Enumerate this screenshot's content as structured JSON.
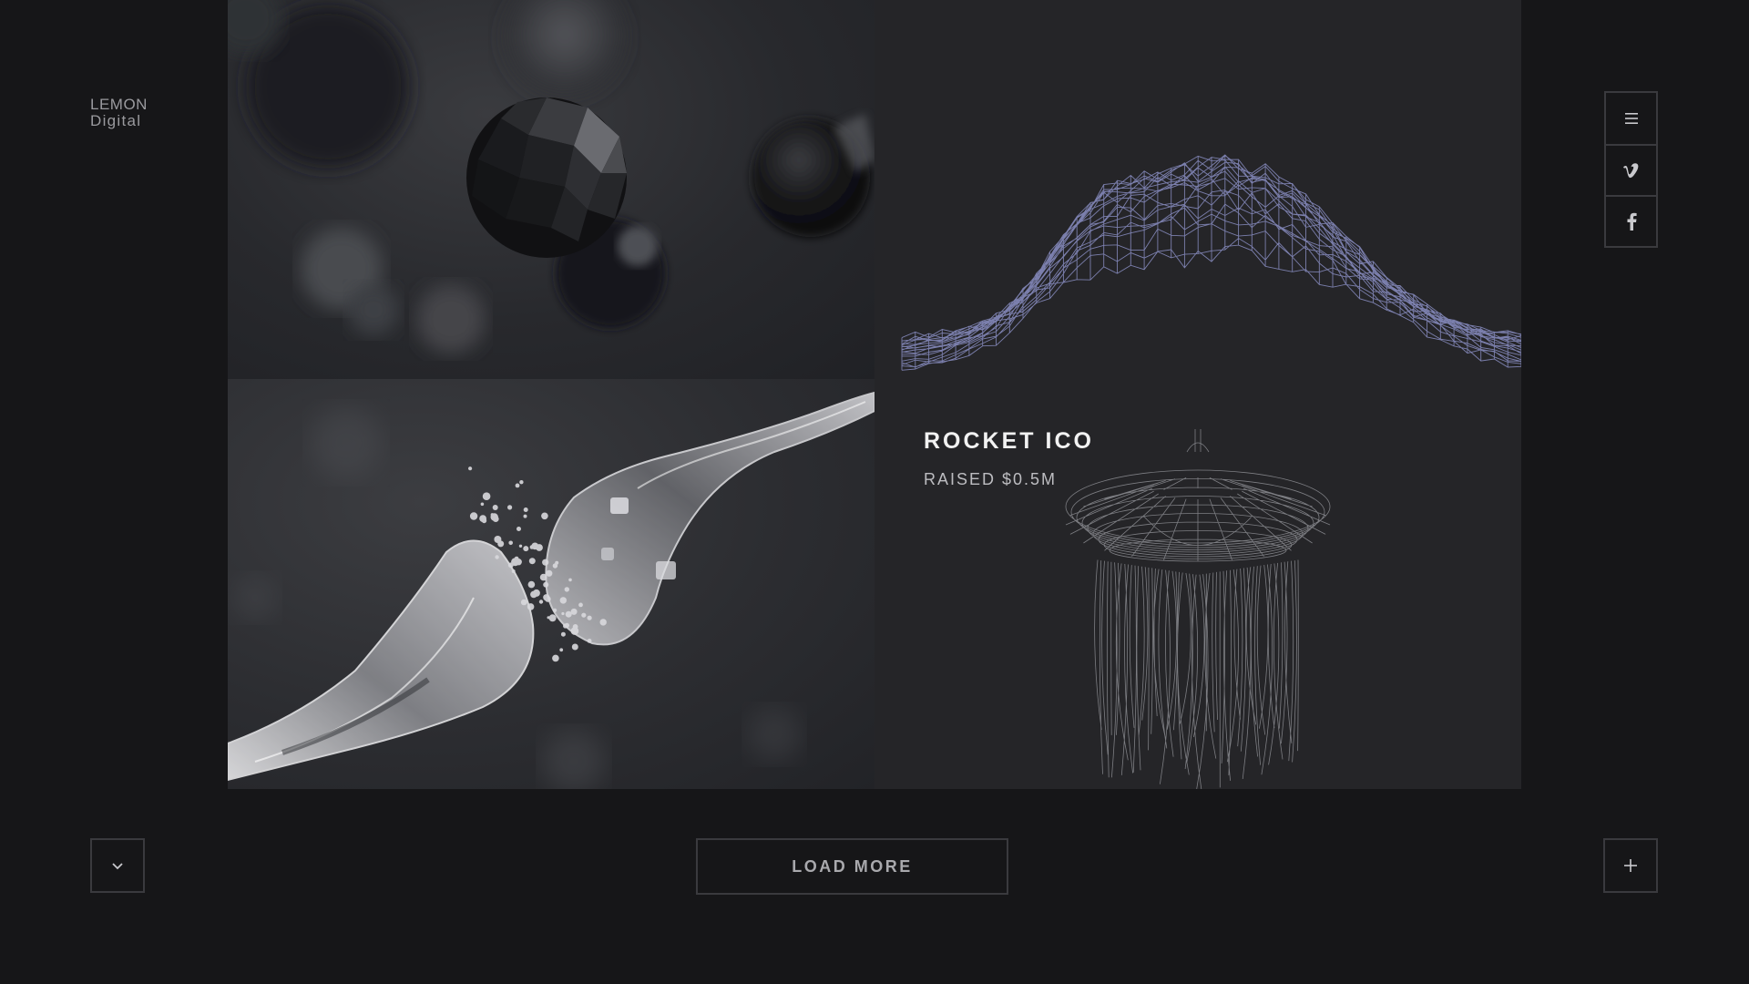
{
  "brand": {
    "line1": "LEMON",
    "line2": "Digital"
  },
  "side_nav": [
    {
      "icon": "menu-icon"
    },
    {
      "icon": "vimeo-icon"
    },
    {
      "icon": "facebook-icon"
    }
  ],
  "projects": [
    {
      "image": "dark-faceted-spheres"
    },
    {
      "image": "wireframe-mountain"
    },
    {
      "image": "glass-synapse"
    },
    {
      "image": "wireframe-jellyfish",
      "title": "ROCKET ICO",
      "subtitle": "RAISED $0.5M"
    }
  ],
  "controls": {
    "load_more_label": "LOAD MORE",
    "scroll_icon": "chevron-down-icon",
    "add_icon": "plus-icon"
  },
  "colors": {
    "background": "#161618",
    "tile_dark": "#252528",
    "border": "#3a3a3e",
    "wireframe": "#8b8fc4"
  }
}
